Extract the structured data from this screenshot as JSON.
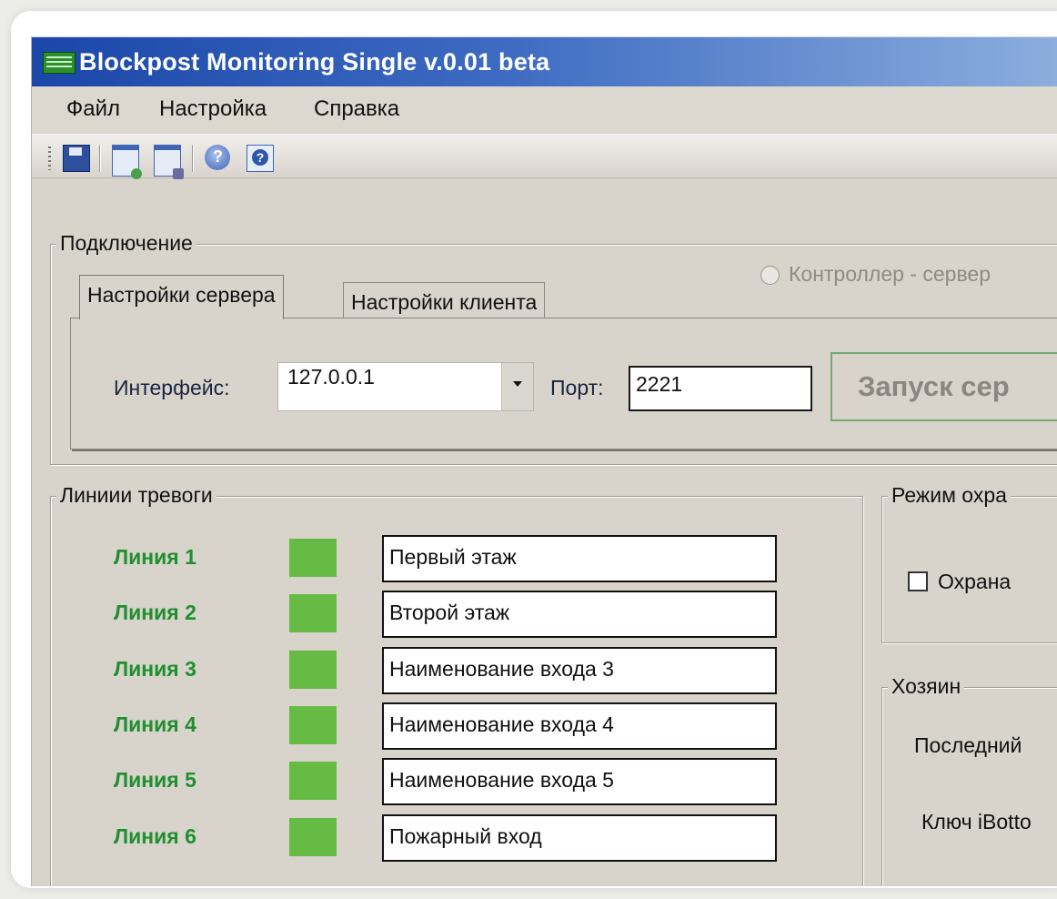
{
  "window": {
    "title": "Blockpost Monitoring Single v.0.01 beta"
  },
  "menu": {
    "items": [
      "Файл",
      "Настройка",
      "Справка"
    ]
  },
  "toolbar": {
    "icons": [
      "floppy-icon",
      "window-icon",
      "settings-icon",
      "help-icon",
      "about-icon"
    ]
  },
  "connection": {
    "legend": "Подключение",
    "tabs": [
      "Настройки сервера",
      "Настройки клиента"
    ],
    "radio_label": "Контроллер - сервер",
    "interface_label": "Интерфейс:",
    "interface_value": "127.0.0.1",
    "port_label": "Порт:",
    "port_value": "2221",
    "start_button": "Запуск сер"
  },
  "alarm_lines": {
    "legend": "Линиии тревоги",
    "indicator_color": "#66bb44",
    "lines": [
      {
        "label": "Линия 1",
        "name": "Первый этаж"
      },
      {
        "label": "Линия 2",
        "name": "Второй этаж"
      },
      {
        "label": "Линия 3",
        "name": "Наименование входа 3"
      },
      {
        "label": "Линия 4",
        "name": "Наименование входа 4"
      },
      {
        "label": "Линия 5",
        "name": "Наименование входа 5"
      },
      {
        "label": "Линия 6",
        "name": "Пожарный вход"
      }
    ]
  },
  "guard_mode": {
    "legend": "Режим охра",
    "checkbox_label": "Охрана"
  },
  "owner": {
    "legend": "Хозяин",
    "last_label": "Последний",
    "key_label": "Ключ iBotto"
  }
}
